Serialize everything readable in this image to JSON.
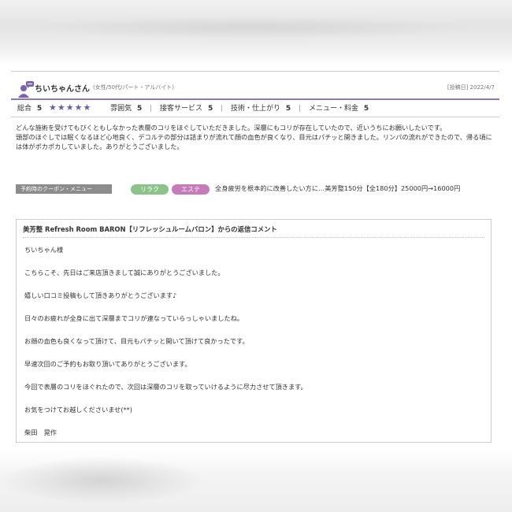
{
  "review": {
    "reviewer": {
      "name": "ちいちゃんさん",
      "meta": "(女性/50代/パート・アルバイト)",
      "avatar_icon": "user-chat-icon"
    },
    "date": "[投稿日] 2022/4/7",
    "ratings": {
      "overall_label": "総合",
      "overall_value": "5",
      "stars": "★★★★★",
      "star_color": "#6b5aa6",
      "items": [
        {
          "label": "雰囲気",
          "value": "5"
        },
        {
          "label": "接客サービス",
          "value": "5"
        },
        {
          "label": "技術・仕上がり",
          "value": "5"
        },
        {
          "label": "メニュー・料金",
          "value": "5"
        }
      ]
    },
    "body": [
      "どんな施術を受けてもびくともしなかった表層のコリをほぐしていただきました。深層にもコリが存在していたので、近いうちにお願いしたいです。",
      "頭部のほぐしでは眠くなるほど心地良く、デコルテの部分は詰まりが流れて顔の血色が良くなり、目元はパチッと開きました。リンパの流れができたので、帰る頃には体がポカポカしていました。ありがとうございました。"
    ],
    "coupon": {
      "label": "予約時のクーポン・メニュー",
      "tags": [
        {
          "text": "リラク",
          "color": "#8cc38a"
        },
        {
          "text": "エステ",
          "color": "#c57ab9"
        }
      ],
      "text": "全身疲労を根本的に改善したい方に…美芳整150分【全180分】25000円→16000円"
    },
    "reply": {
      "title": "美芳整 Refresh Room BARON【リフレッシュルームバロン】からの返信コメント",
      "lines": [
        "ちいちゃん様",
        "こちらこそ、先日はご来店頂きまして誠にありがとうございました。",
        "嬉しい口コミ投稿もして頂きありがとうございます♪",
        "日々のお疲れが全身に出て深層までコリが連なっていらっしゃいましたね。",
        "お顔の血色も良くなって頂けて、目元もパチッと開いて頂けて良かったです。",
        "早速次回のご予約もお取り頂いてありがとうございます。",
        "今回で表層のコリをほぐれたので、次回は深層のコリを取っていけるように尽力させて頂きます。",
        "お気をつけてお越しくださいませ(**)",
        "柴田　晃作"
      ]
    }
  }
}
